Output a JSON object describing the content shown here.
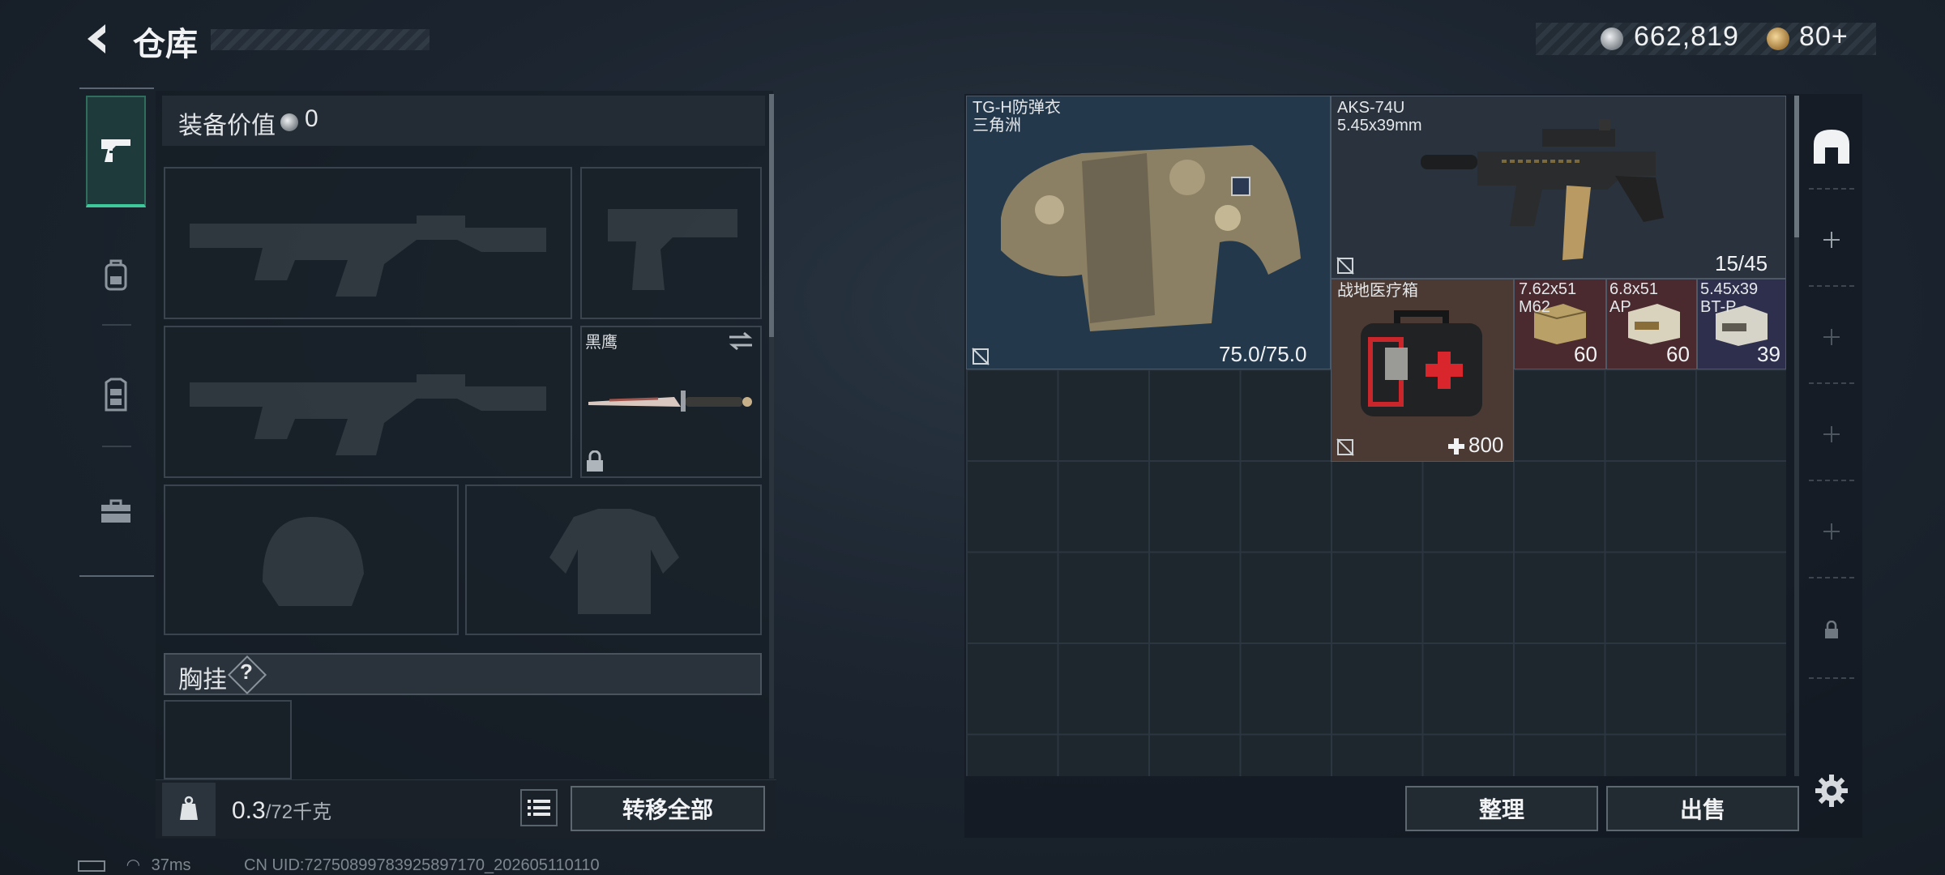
{
  "header": {
    "title": "仓库"
  },
  "currency": {
    "coins": "662,819",
    "tokens": "80+"
  },
  "loadout": {
    "value_label": "装备价值",
    "value": "0",
    "knife_slot_label": "黑鹰",
    "vest_label": "胸挂",
    "vest_help": "?"
  },
  "bottom": {
    "weight_current": "0.3",
    "weight_capacity": "/72千克",
    "transfer_all": "转移全部",
    "organize": "整理",
    "sell": "出售"
  },
  "stash_items": [
    {
      "name_line1": "TG-H防弹衣",
      "name_line2": "三角洲",
      "count": "75.0/75.0"
    },
    {
      "name_line1": "AKS-74U",
      "name_line2": "5.45x39mm",
      "count": "15/45"
    },
    {
      "name_line1": "战地医疗箱",
      "name_line2": "",
      "count": "800"
    },
    {
      "name_line1": "7.62x51",
      "name_line2": "M62",
      "count": "60"
    },
    {
      "name_line1": "6.8x51",
      "name_line2": "AP",
      "count": "60"
    },
    {
      "name_line1": "5.45x39",
      "name_line2": "BT-P",
      "count": "39"
    }
  ],
  "status": {
    "ping": "37ms",
    "uid": "CN UID:72750899783925897170_202605110110"
  },
  "colors": {
    "accent_green": "#3fc99a",
    "armor_bg": "#24384c",
    "medkit_bg": "#4a3a33",
    "ammo_red": "#4a2a2e",
    "ammo_blue": "#2e2f4c"
  },
  "icons": [
    "back-arrow-icon",
    "silver-coin-icon",
    "gold-token-icon",
    "pistol-icon",
    "backpack-icon",
    "vest-icon",
    "toolbox-icon",
    "weight-kg-icon",
    "list-icon",
    "lock-icon",
    "swap-icon",
    "no-insure-icon",
    "heal-plus-icon",
    "safe-box-icon",
    "plus-icon",
    "settings-gear-icon"
  ]
}
